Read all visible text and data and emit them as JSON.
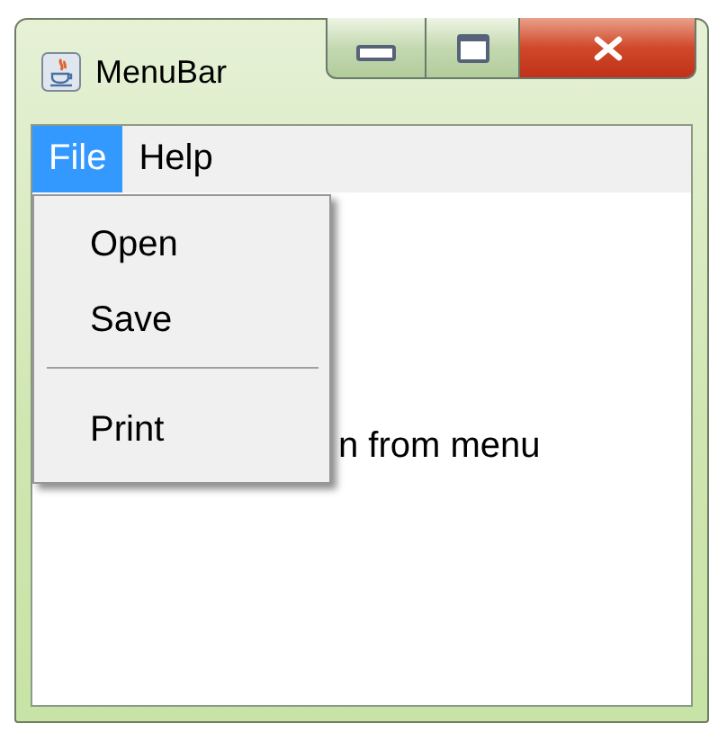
{
  "window": {
    "title": "MenuBar"
  },
  "menu_bar": [
    {
      "label": "File",
      "selected": true
    },
    {
      "label": "Help",
      "selected": false
    }
  ],
  "open_menu": {
    "items": [
      {
        "kind": "item",
        "label": "Open"
      },
      {
        "kind": "item",
        "label": "Save"
      },
      {
        "kind": "separator"
      },
      {
        "kind": "item",
        "label": "Print"
      }
    ]
  },
  "content": {
    "label": "n from menu"
  }
}
